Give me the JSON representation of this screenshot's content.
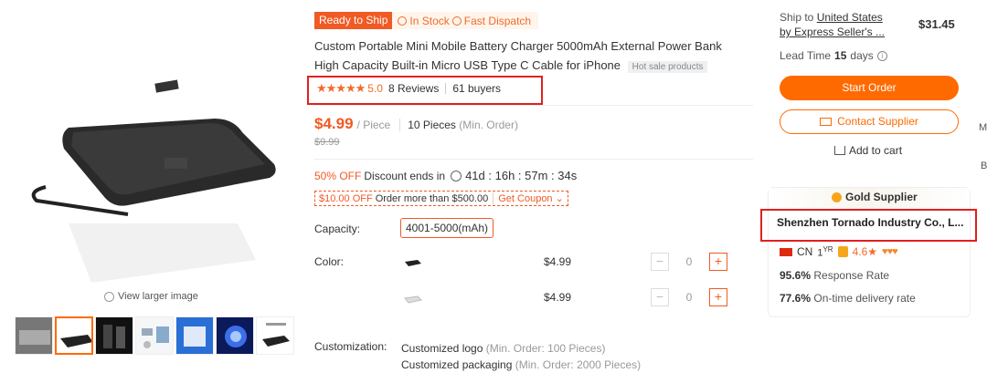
{
  "gallery": {
    "view_larger": "View larger image",
    "thumbnail_count": 7
  },
  "badges": {
    "ready": "Ready to Ship",
    "stock": "In Stock",
    "dispatch": "Fast Dispatch"
  },
  "product": {
    "title": "Custom Portable Mini Mobile Battery Charger 5000mAh External Power Bank High Capacity Built-in Micro USB Type C Cable for iPhone",
    "hot_tag": "Hot sale products",
    "rating_stars": 5,
    "rating_score": "5.0",
    "reviews": "8 Reviews",
    "buyers": "61 buyers"
  },
  "pricing": {
    "price": "$4.99",
    "unit": "/ Piece",
    "moq": "10 Pieces",
    "moq_note": "(Min. Order)",
    "old_price": "$9.99",
    "discount_pct": "50% OFF",
    "discount_text": "Discount ends in",
    "countdown": "41d : 16h : 57m : 34s",
    "coupon_amount": "$10.00 OFF",
    "coupon_text": "Order more than $500.00",
    "coupon_action": "Get Coupon"
  },
  "options": {
    "capacity_label": "Capacity:",
    "capacity_value": "4001-5000(mAh)",
    "color_label": "Color:",
    "colors": [
      {
        "price": "$4.99",
        "qty": "0"
      },
      {
        "price": "$4.99",
        "qty": "0"
      }
    ],
    "customization_label": "Customization:",
    "customizations": [
      {
        "name": "Customized logo",
        "note": "(Min. Order: 100 Pieces)"
      },
      {
        "name": "Customized packaging",
        "note": "(Min. Order: 2000 Pieces)"
      }
    ]
  },
  "shipping": {
    "ship_to_prefix": "Ship to",
    "ship_to_country": "United States",
    "ship_by": "by Express Seller's ...",
    "ship_price": "$31.45",
    "lead_label": "Lead Time",
    "lead_days": "15",
    "lead_unit": "days"
  },
  "actions": {
    "start_order": "Start Order",
    "contact_supplier": "Contact Supplier",
    "add_to_cart": "Add to cart"
  },
  "supplier": {
    "tier": "Gold Supplier",
    "name": "Shenzhen Tornado Industry Co., L...",
    "country": "CN",
    "years": "1",
    "years_unit": "YR",
    "score": "4.6",
    "response_rate": "95.6%",
    "response_label": "Response Rate",
    "ontime_rate": "77.6%",
    "ontime_label": "On-time delivery rate"
  },
  "edge": {
    "m": "M",
    "b": "B"
  },
  "colors": {
    "accent": "#ff6a00",
    "highlight": "#e02020"
  }
}
